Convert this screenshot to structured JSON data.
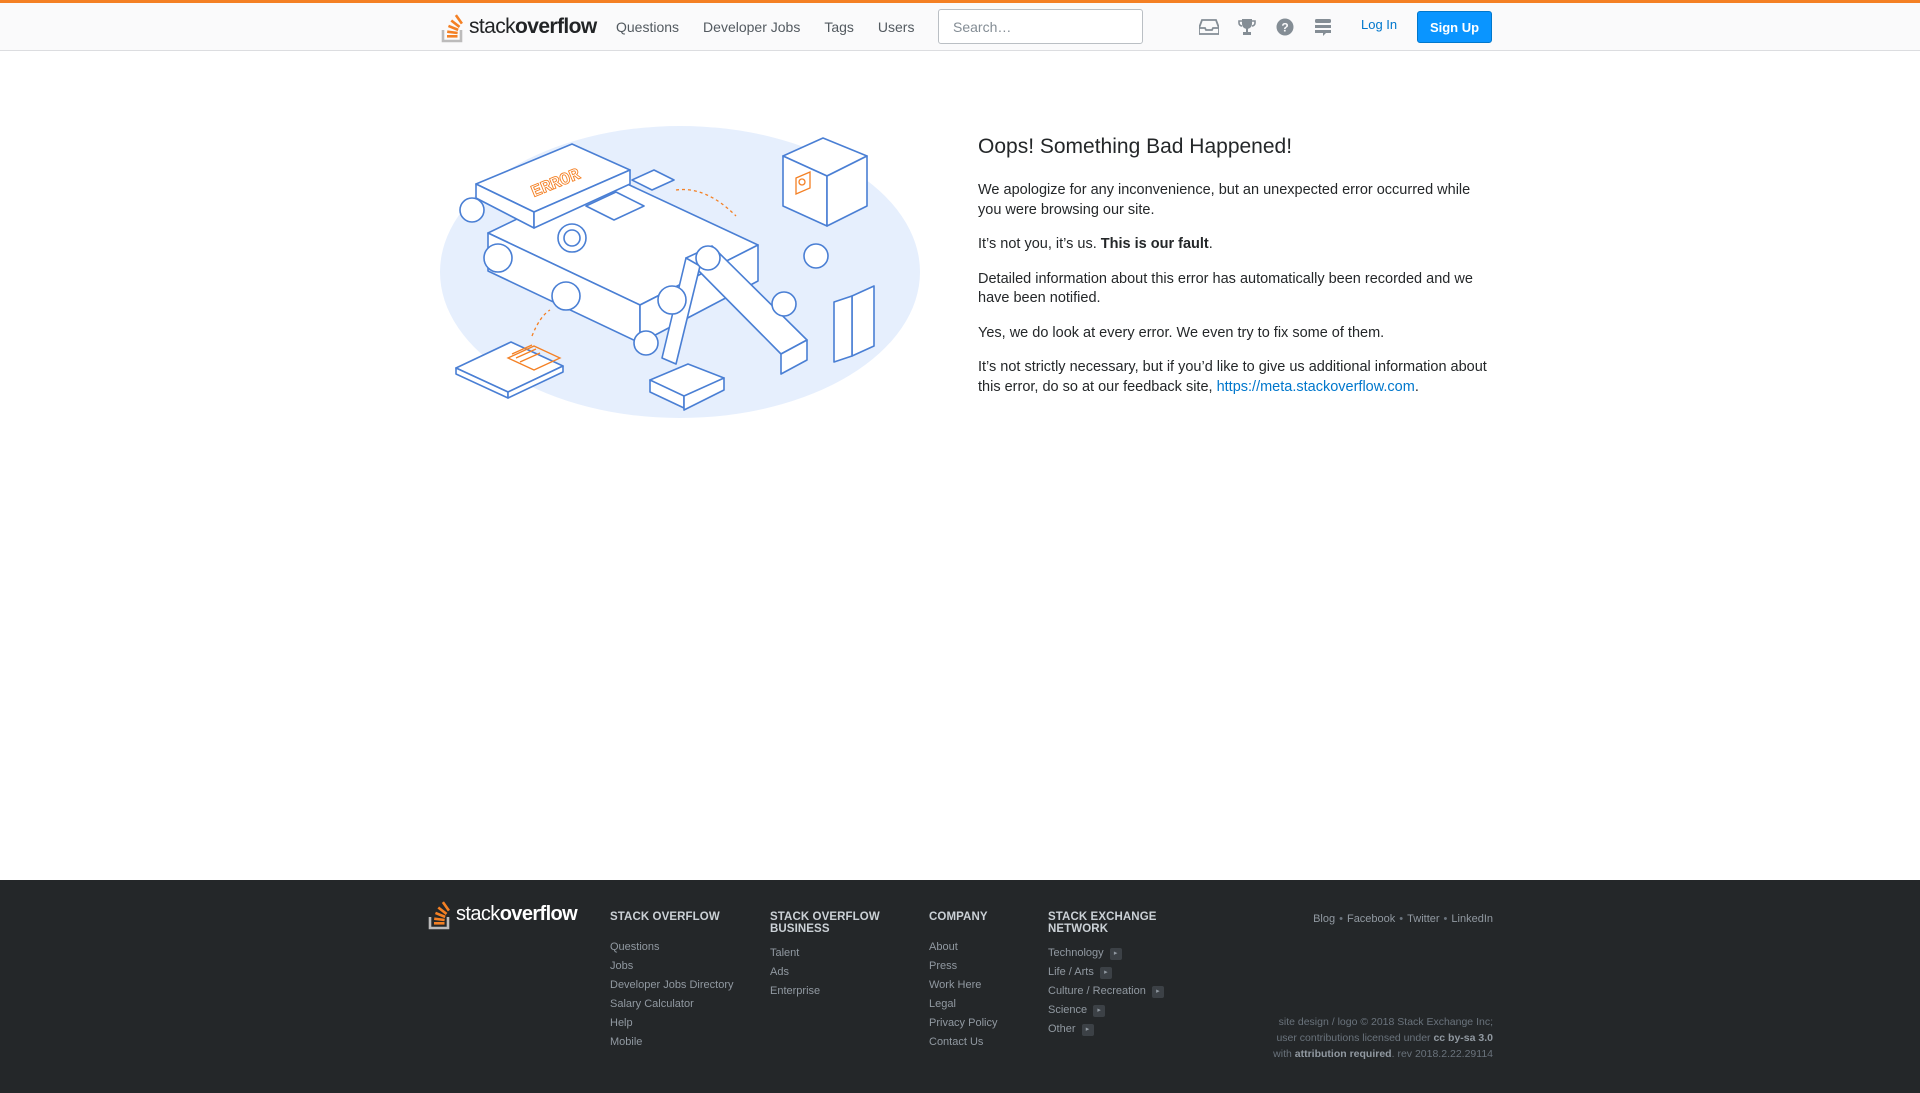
{
  "header": {
    "logo_text_light": "stack",
    "logo_text_bold": "overflow",
    "nav": [
      "Questions",
      "Developer Jobs",
      "Tags",
      "Users"
    ],
    "search_placeholder": "Search…",
    "icons": [
      "inbox-icon",
      "achievements-trophy-icon",
      "help-icon",
      "site-switcher-icon"
    ],
    "login": "Log In",
    "signup": "Sign Up",
    "accent_color": "#f48024",
    "link_color": "#0077cc",
    "signup_color": "#0a95ff"
  },
  "error": {
    "title": "Oops! Something Bad Happened!",
    "p1": "We apologize for any inconvenience, but an unexpected error occurred while you were browsing our site.",
    "p2_prefix": "It’s not you, it’s us. ",
    "p2_bold": "This is our fault",
    "p2_suffix": ".",
    "p3": "Detailed information about this error has automatically been recorded and we have been notified.",
    "p4": "Yes, we do look at every error. We even try to fix some of them.",
    "p5_prefix": "It’s not strictly necessary, but if you’d like to give us additional information about this error, do so at our feedback site, ",
    "p5_link": "https://meta.stackoverflow.com",
    "p5_suffix": ".",
    "illustration_text": "ERROR"
  },
  "footer": {
    "logo_text_light": "stack",
    "logo_text_bold": "overflow",
    "columns": [
      {
        "title": "Stack Overflow",
        "items": [
          "Questions",
          "Jobs",
          "Developer Jobs Directory",
          "Salary Calculator",
          "Help",
          "Mobile"
        ]
      },
      {
        "title": "Stack Overflow Business",
        "items": [
          "Talent",
          "Ads",
          "Enterprise"
        ]
      },
      {
        "title": "Company",
        "items": [
          "About",
          "Press",
          "Work Here",
          "Legal",
          "Privacy Policy",
          "Contact Us"
        ]
      },
      {
        "title": "Stack Exchange Network",
        "items": [
          "Technology",
          "Life / Arts",
          "Culture / Recreation",
          "Science",
          "Other"
        ]
      }
    ],
    "social": [
      "Blog",
      "Facebook",
      "Twitter",
      "LinkedIn"
    ],
    "copyright_line1": "site design / logo © 2018 Stack Exchange Inc;",
    "copyright_line2_prefix": "user contributions licensed under ",
    "copyright_line2_bold": "cc by-sa 3.0",
    "copyright_line3_prefix": "with ",
    "copyright_line3_bold": "attribution required",
    "copyright_line3_suffix": ". rev 2018.2.22.29114",
    "background_color": "#242729"
  }
}
